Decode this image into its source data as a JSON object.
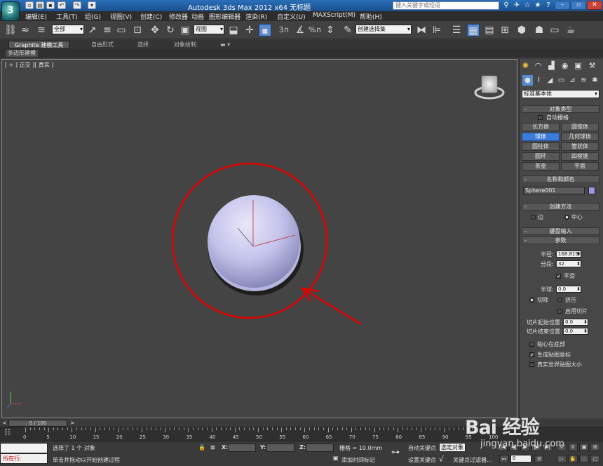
{
  "title_bar": {
    "title": "Autodesk 3ds Max  2012 x64     无标题",
    "search_placeholder": "键入关键字或短语"
  },
  "menu": [
    "编辑(E)",
    "工具(T)",
    "组(G)",
    "视图(V)",
    "创建(C)",
    "修改器",
    "动画",
    "图形编辑器",
    "渲染(R)",
    "自定义(U)",
    "MAXScript(M)",
    "帮助(H)"
  ],
  "toolbar": {
    "selection_filter": "全部",
    "reference_coord": "视图",
    "named_selection": "创建选择集"
  },
  "ribbon": {
    "tabs": [
      "Graphite 建模工具",
      "自由形式",
      "选择",
      "对象绘制"
    ],
    "sub_label": "多边形建模"
  },
  "viewport": {
    "label": "[ + ] 正交 ][ 真实 ]",
    "sphere_color": "#c3c2ea",
    "annotation_color": "#e00000"
  },
  "command_panel": {
    "category": "标准基本体",
    "object_type": {
      "header": "对象类型",
      "autogrid": "自动栅格",
      "buttons": [
        "长方体",
        "圆锥体",
        "球体",
        "几何球体",
        "圆柱体",
        "管状体",
        "圆环",
        "四棱锥",
        "茶壶",
        "平面"
      ],
      "active": "球体"
    },
    "name_color": {
      "header": "名称和颜色",
      "name": "Sphere001",
      "color": "#9a9ae8"
    },
    "creation_method": {
      "header": "创建方法",
      "options": [
        "边",
        "中心"
      ],
      "selected": "中心"
    },
    "keyboard_entry": "键盘输入",
    "parameters": {
      "header": "参数",
      "radius_label": "半径:",
      "radius": "168.819m",
      "segments_label": "分段:",
      "segments": "32",
      "smooth": "平滑",
      "hemisphere_label": "半球:",
      "hemisphere": "0.0",
      "chop": "切除",
      "squash": "挤压",
      "enable_slice": "启用切片",
      "slice_from_label": "切片起始位置:",
      "slice_from": "0.0",
      "slice_to_label": "切片结束位置:",
      "slice_to": "0.0",
      "base_to_pivot": "轴心在底部",
      "gen_mapping": "生成贴图坐标",
      "real_world": "真实世界贴图大小"
    }
  },
  "timeline": {
    "frame": "0 / 100",
    "ticks": [
      "0",
      "5",
      "10",
      "15",
      "20",
      "25",
      "30",
      "35",
      "40",
      "45",
      "50",
      "55",
      "60",
      "65",
      "70",
      "75",
      "80",
      "85",
      "90",
      "95",
      "100"
    ]
  },
  "status": {
    "script_line": "所在行:",
    "selection": "选择了 1 个 对象",
    "prompt": "单击并拖动以开始创建过程",
    "x_label": "X:",
    "y_label": "Y:",
    "z_label": "Z:",
    "grid": "栅格 = 10.0mm",
    "add_time_tag": "添加时间标记",
    "auto_key": "自动关键点",
    "selected": "选定对象",
    "set_key": "设置关键点",
    "key_filters": "关键点过滤器...",
    "frame_field": "0"
  },
  "watermark": {
    "brand": "Bai 经验",
    "url": "jingyan.baidu.com"
  }
}
